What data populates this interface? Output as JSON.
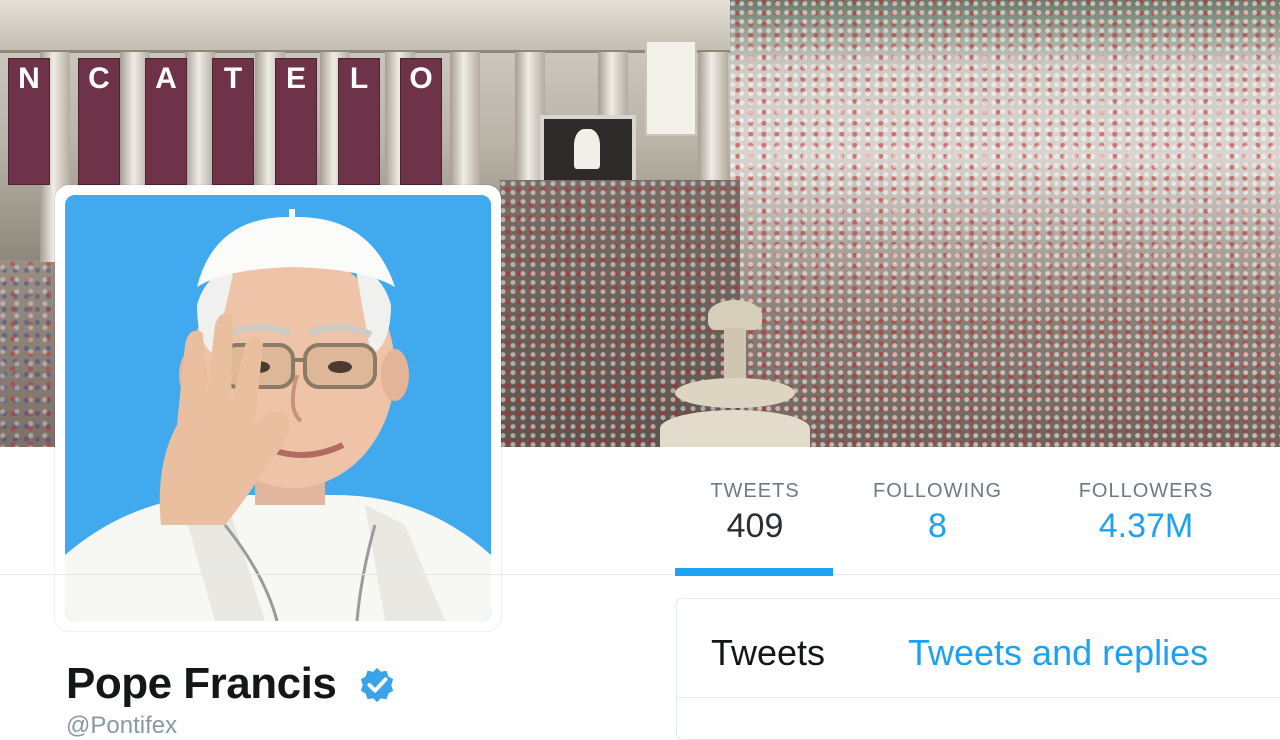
{
  "profile": {
    "name": "Pope Francis",
    "verified_icon": "verified-badge-icon",
    "handle": "@Pontifex"
  },
  "stats": [
    {
      "label": "TWEETS",
      "value": "409"
    },
    {
      "label": "FOLLOWING",
      "value": "8"
    },
    {
      "label": "FOLLOWERS",
      "value": "4.37M"
    }
  ],
  "timeline": {
    "tabs": [
      "Tweets",
      "Tweets and replies"
    ]
  },
  "banner": {
    "flags": [
      "N",
      "C",
      "A",
      "T",
      "E",
      "L",
      "O"
    ]
  },
  "colors": {
    "accent": "#1da1f2",
    "avatar_bg": "#41a9ee",
    "text_dark": "#14171a",
    "text_muted": "#6a7b87"
  }
}
